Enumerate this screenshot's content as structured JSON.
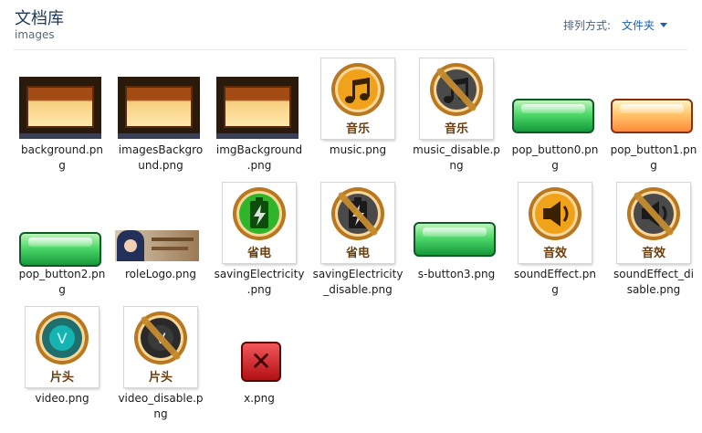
{
  "header": {
    "library_title": "文档库",
    "folder_name": "images",
    "arrange_label": "排列方式:",
    "arrange_value": "文件夹"
  },
  "files": [
    {
      "name": "background.png",
      "label": "background.pn\ng",
      "kind": "bg"
    },
    {
      "name": "imagesBackground.png",
      "label": "imagesBackgro\nund.png",
      "kind": "bg"
    },
    {
      "name": "imgBackground.png",
      "label": "imgBackground\n.png",
      "kind": "bg"
    },
    {
      "name": "music.png",
      "label": "music.png",
      "kind": "icon",
      "caption": "音乐",
      "symbol": "music"
    },
    {
      "name": "music_disable.png",
      "label": "music_disable.p\nng",
      "kind": "icon",
      "caption": "音乐",
      "symbol": "music",
      "disabled": true
    },
    {
      "name": "pop_button0.png",
      "label": "pop_button0.pn\ng",
      "kind": "green-button"
    },
    {
      "name": "pop_button1.png",
      "label": "pop_button1.pn\ng",
      "kind": "orange-button"
    },
    {
      "name": "pop_button2.png",
      "label": "pop_button2.pn\ng",
      "kind": "green-button"
    },
    {
      "name": "roleLogo.png",
      "label": "roleLogo.png",
      "kind": "role"
    },
    {
      "name": "savingElectricity.png",
      "label": "savingElectricity\n.png",
      "kind": "icon",
      "caption": "省电",
      "symbol": "battery"
    },
    {
      "name": "savingElectricity_disable.png",
      "label": "savingElectricity\n_disable.png",
      "kind": "icon",
      "caption": "省电",
      "symbol": "battery",
      "disabled": true
    },
    {
      "name": "s-button3.png",
      "label": "s-button3.png",
      "kind": "green-button"
    },
    {
      "name": "soundEffect.png",
      "label": "soundEffect.pn\ng",
      "kind": "icon",
      "caption": "音效",
      "symbol": "speaker"
    },
    {
      "name": "soundEffect_disable.png",
      "label": "soundEffect_di\nsable.png",
      "kind": "icon",
      "caption": "音效",
      "symbol": "speaker",
      "disabled": true
    },
    {
      "name": "video.png",
      "label": "video.png",
      "kind": "icon",
      "caption": "片头",
      "symbol": "video"
    },
    {
      "name": "video_disable.png",
      "label": "video_disable.p\nng",
      "kind": "icon",
      "caption": "片头",
      "symbol": "video",
      "disabled": true
    },
    {
      "name": "x.png",
      "label": "x.png",
      "kind": "x",
      "glyph": "✕"
    }
  ],
  "colors": {
    "icon_ring": "#b9771f",
    "icon_disc_on": "#f0a31a",
    "icon_disc_off": "#4a4a4a",
    "caption_text": "#6a3e0e",
    "disable_slash": "#c68b2e"
  }
}
